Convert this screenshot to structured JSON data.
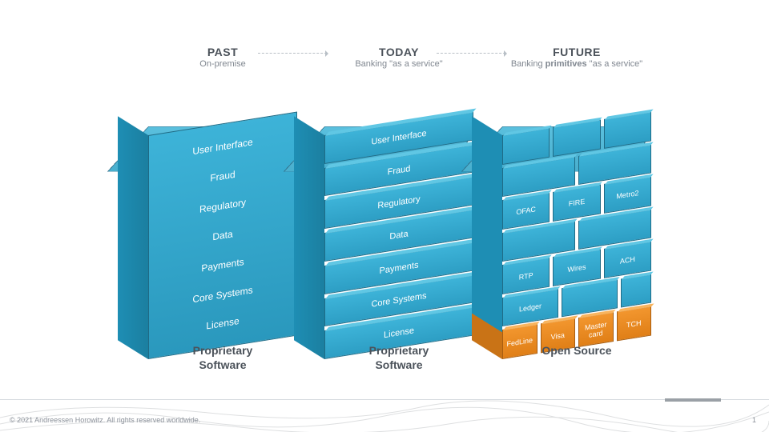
{
  "eras": [
    {
      "title": "PAST",
      "subtitle": "On-premise",
      "caption": "Proprietary\nSoftware",
      "stack": [
        "User Interface",
        "Fraud",
        "Regulatory",
        "Data",
        "Payments",
        "Core Systems",
        "License"
      ]
    },
    {
      "title": "TODAY",
      "subtitle": "Banking \"as a service\"",
      "caption": "Proprietary\nSoftware",
      "stack": [
        "User Interface",
        "Fraud",
        "Regulatory",
        "Data",
        "Payments",
        "Core Systems",
        "License"
      ]
    },
    {
      "title": "FUTURE",
      "subtitle_html": "Banking <b>primitives</b> \"as a service\"",
      "caption": "Open Source",
      "rows": [
        [
          "",
          "",
          ""
        ],
        [
          "",
          ""
        ],
        [
          "OFAC",
          "FIRE",
          "Metro2"
        ],
        [
          "",
          ""
        ],
        [
          "RTP",
          "Wires",
          "ACH"
        ],
        [
          "Ledger",
          "",
          ""
        ],
        [
          "FedLine",
          "Visa",
          "Master\ncard",
          "TCH"
        ]
      ]
    }
  ],
  "footer": {
    "credit": "© 2021 Andreessen Horowitz.   All rights reserved worldwide.",
    "page": "1"
  },
  "colors": {
    "cyan": "#3db3d8",
    "cyan_dark": "#1e8eb4",
    "orange": "#f2962e"
  }
}
